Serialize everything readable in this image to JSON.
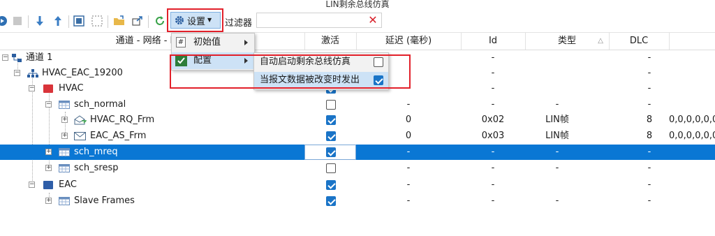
{
  "window": {
    "title": "LIN剩余总线仿真"
  },
  "toolbar": {
    "settings_label": "设置",
    "filter_label": "过滤器",
    "filter_value": "",
    "clear_label": "✕"
  },
  "columns": {
    "tree": "通道 - 网络 - ECU",
    "active": "激活",
    "delay": "延迟 (毫秒)",
    "id": "Id",
    "type": "类型",
    "dlc": "DLC"
  },
  "rows": [
    {
      "label": "通道 1",
      "active": "",
      "delay": "",
      "id": "-",
      "type": "",
      "dlc": "-",
      "data": ""
    },
    {
      "label": "HVAC_EAC_19200",
      "active": "",
      "delay": "",
      "id": "-",
      "type": "",
      "dlc": "-",
      "data": ""
    },
    {
      "label": "HVAC",
      "active": "on",
      "delay": "",
      "id": "-",
      "type": "",
      "dlc": "-",
      "data": ""
    },
    {
      "label": "sch_normal",
      "active": "off",
      "delay": "-",
      "id": "-",
      "type": "-",
      "dlc": "-",
      "data": ""
    },
    {
      "label": "HVAC_RQ_Frm",
      "active": "on",
      "delay": "0",
      "id": "0x02",
      "type": "LIN帧",
      "dlc": "8",
      "data": "0,0,0,0,0,0"
    },
    {
      "label": "EAC_AS_Frm",
      "active": "on",
      "delay": "0",
      "id": "0x03",
      "type": "LIN帧",
      "dlc": "8",
      "data": "0,0,0,0,0,0"
    },
    {
      "label": "sch_mreq",
      "active": "on",
      "delay": "-",
      "id": "-",
      "type": "-",
      "dlc": "-",
      "data": ""
    },
    {
      "label": "sch_sresp",
      "active": "off",
      "delay": "-",
      "id": "-",
      "type": "-",
      "dlc": "-",
      "data": ""
    },
    {
      "label": "EAC",
      "active": "on",
      "delay": "-",
      "id": "-",
      "type": "",
      "dlc": "-",
      "data": ""
    },
    {
      "label": "Slave Frames",
      "active": "on",
      "delay": "-",
      "id": "-",
      "type": "-",
      "dlc": "-",
      "data": ""
    }
  ],
  "menu": {
    "item1": "初始值",
    "item2": "配置",
    "sub1": "自动启动剩余总线仿真",
    "sub2": "当报文数据被改变时发出"
  },
  "colors": {
    "accent": "#0a77d4",
    "highlight": "#e2202a",
    "hvac": "#d9343a",
    "eac": "#2e5ea8"
  }
}
